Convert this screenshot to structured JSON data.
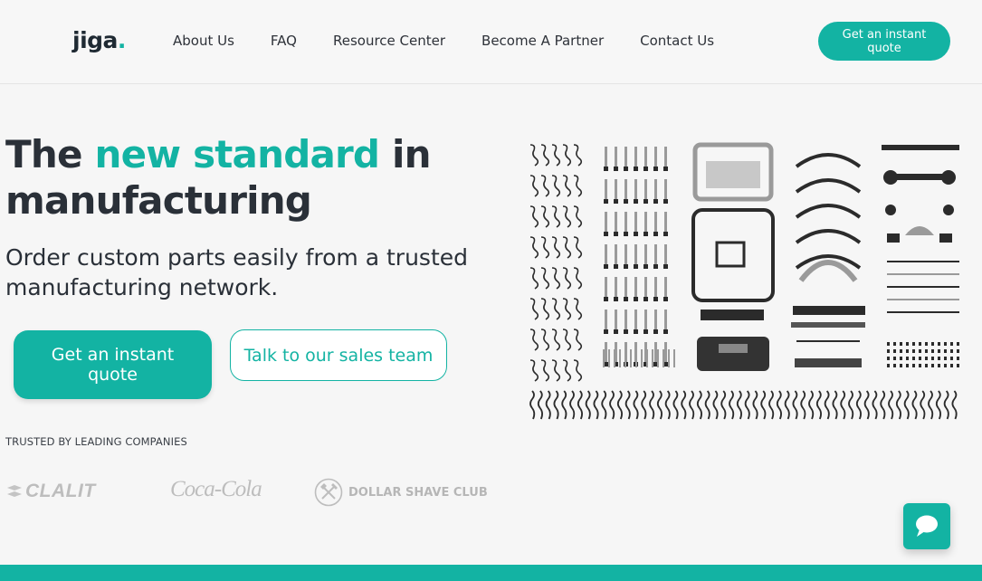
{
  "header": {
    "logo_text": "jiga",
    "logo_dot": ".",
    "nav": [
      "About Us",
      "FAQ",
      "Resource Center",
      "Become A Partner",
      "Contact Us"
    ],
    "cta": "Get an instant quote"
  },
  "hero": {
    "title_part1": "The ",
    "title_accent": "new standard",
    "title_part2": " in",
    "title_line2": "manufacturing",
    "subtitle": "Order custom parts easily from a trusted manufacturing network.",
    "primary_cta": "Get an instant quote",
    "secondary_cta": "Talk to our sales team"
  },
  "trusted": {
    "label": "TRUSTED BY LEADING COMPANIES",
    "logos": [
      "CLALIT",
      "Coca-Cola",
      "DOLLAR SHAVE CLUB"
    ]
  },
  "colors": {
    "accent": "#13b3a3",
    "text_dark": "#2a3038",
    "background": "#f6f6f6"
  },
  "icons": {
    "chat": "chat-bubble-icon",
    "dsc": "crossed-tools-icon"
  }
}
